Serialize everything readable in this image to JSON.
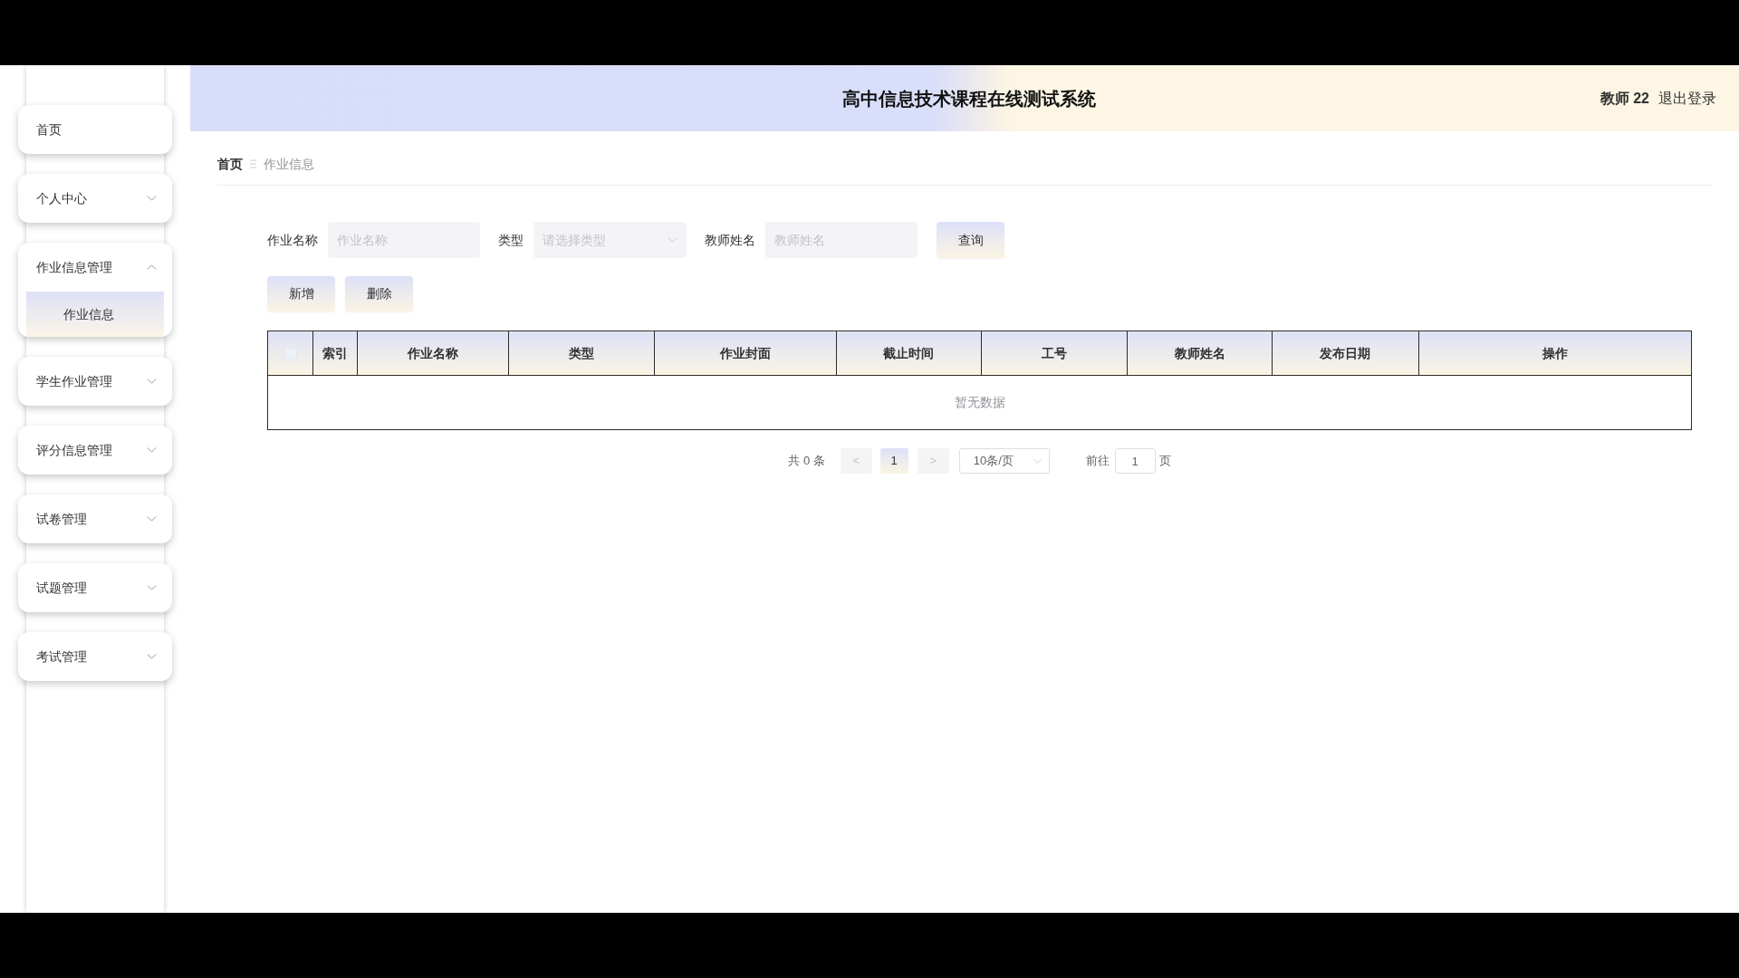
{
  "header": {
    "title": "高中信息技术课程在线测试系统",
    "user": "教师 22",
    "logout": "退出登录"
  },
  "sidebar": {
    "items": [
      {
        "kind": "link",
        "label": "首页"
      },
      {
        "kind": "group",
        "label": "个人中心",
        "expanded": false
      },
      {
        "kind": "group",
        "label": "作业信息管理",
        "expanded": true,
        "children": [
          {
            "label": "作业信息",
            "selected": true
          }
        ]
      },
      {
        "kind": "group",
        "label": "学生作业管理",
        "expanded": false
      },
      {
        "kind": "group",
        "label": "评分信息管理",
        "expanded": false
      },
      {
        "kind": "group",
        "label": "试卷管理",
        "expanded": false
      },
      {
        "kind": "group",
        "label": "试题管理",
        "expanded": false
      },
      {
        "kind": "group",
        "label": "考试管理",
        "expanded": false
      }
    ]
  },
  "breadcrumb": [
    {
      "kind": "link",
      "label": "首页"
    },
    {
      "kind": "current",
      "label": "作业信息"
    }
  ],
  "search": {
    "fields": [
      {
        "kind": "text",
        "label": "作业名称",
        "placeholder": "作业名称"
      },
      {
        "kind": "select",
        "label": "类型",
        "placeholder": "请选择类型"
      },
      {
        "kind": "text",
        "label": "教师姓名",
        "placeholder": "教师姓名"
      }
    ],
    "button": "查询"
  },
  "actions": [
    "新增",
    "删除"
  ],
  "table": {
    "select_all": {
      "checked": false
    },
    "columns": [
      "索引",
      "作业名称",
      "类型",
      "作业封面",
      "截止时间",
      "工号",
      "教师姓名",
      "发布日期",
      "操作"
    ],
    "empty_text": "暂无数据"
  },
  "pagination": {
    "total": "共 0 条",
    "prev": {
      "label": "<",
      "disabled": true
    },
    "pages": [
      {
        "label": "1",
        "selected": true
      }
    ],
    "next": {
      "label": ">",
      "disabled": true
    },
    "page_size": "10条/页",
    "goto_label": "前往",
    "goto_value": "1",
    "goto_suffix": "页"
  }
}
